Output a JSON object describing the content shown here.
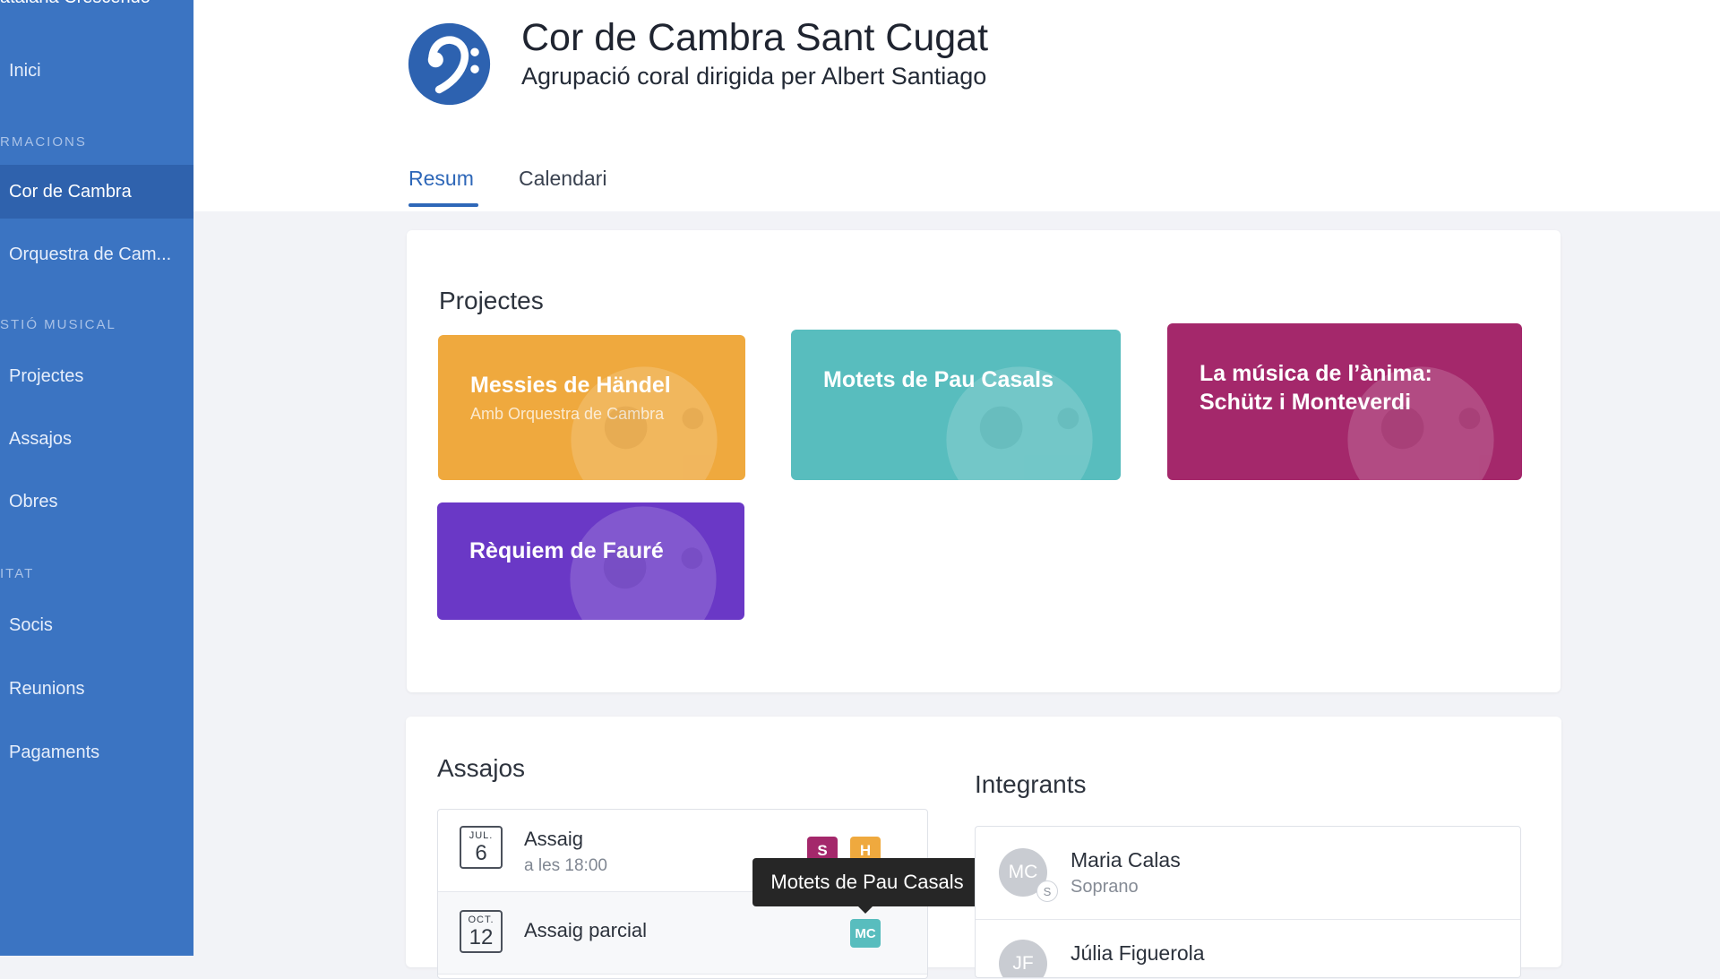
{
  "sidebar": {
    "top_text": "atalana Crescendo",
    "items": {
      "inici": "Inici",
      "cor": "Cor de Cambra",
      "orquestra": "Orquestra de Cam...",
      "projectes": "Projectes",
      "assajos": "Assajos",
      "obres": "Obres",
      "socis": "Socis",
      "reunions": "Reunions",
      "pagaments": "Pagaments"
    },
    "sections": {
      "formacions": "RMACIONS",
      "gestio": "STIÓ MUSICAL",
      "entitat": "ITAT"
    }
  },
  "header": {
    "title": "Cor de Cambra Sant Cugat",
    "subtitle": "Agrupació coral dirigida per Albert Santiago",
    "tabs": [
      "Resum",
      "Calendari"
    ],
    "active_tab": "Resum"
  },
  "projects": {
    "title": "Projectes",
    "items": [
      {
        "title": "Messies de Händel",
        "subtitle": "Amb Orquestra de Cambra",
        "color": "#efa93e"
      },
      {
        "title": "Motets de Pau Casals",
        "subtitle": "",
        "color": "#58bdbe"
      },
      {
        "title": "La música de l’ànima: Schütz i Monteverdi",
        "subtitle": "",
        "color": "#a4286b"
      },
      {
        "title": "Rèquiem de Fauré",
        "subtitle": "",
        "color": "#6a38c6"
      }
    ]
  },
  "rehearsals": {
    "title": "Assajos",
    "items": [
      {
        "month": "JUL.",
        "day": "6",
        "title": "Assaig",
        "time": "a les 18:00",
        "chips": [
          {
            "label": "S",
            "color": "#a4286b"
          },
          {
            "label": "H",
            "color": "#efa93e"
          }
        ]
      },
      {
        "month": "OCT.",
        "day": "12",
        "title": "Assaig parcial",
        "time": "",
        "chips": [
          {
            "label": "MC",
            "color": "#58bdbe"
          }
        ]
      }
    ],
    "tooltip": "Motets de Pau Casals"
  },
  "members": {
    "title": "Integrants",
    "items": [
      {
        "initials": "MC",
        "badge": "S",
        "name": "Maria Calas",
        "role": "Soprano"
      },
      {
        "initials": "JF",
        "badge": "",
        "name": "Júlia Figuerola",
        "role": ""
      }
    ]
  },
  "colors": {
    "sidebar": "#3b74c2",
    "sidebar_active": "#2f62ad",
    "accent": "#2e67b8",
    "logo": "#2d62b0"
  },
  "icons": {
    "logo": "bass-clef-icon",
    "project_watermark": "bass-clef-icon"
  }
}
